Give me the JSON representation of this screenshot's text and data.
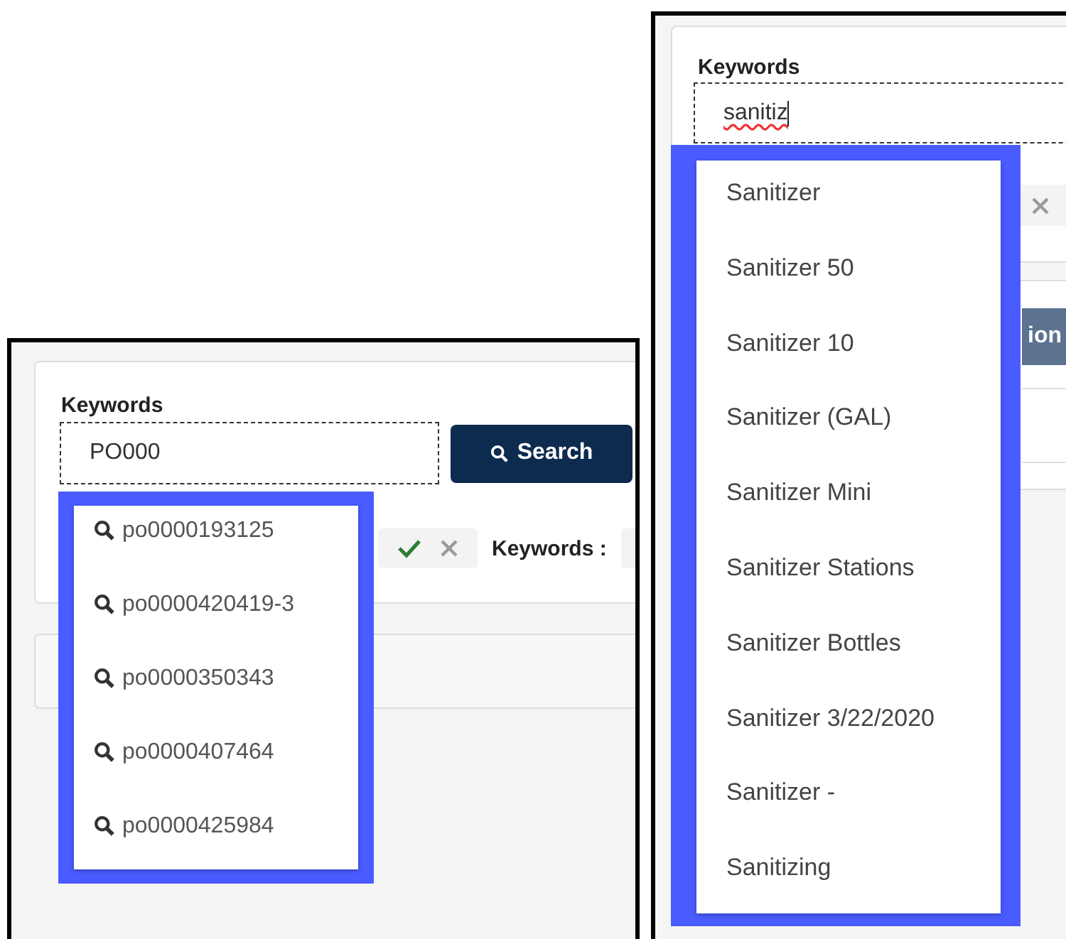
{
  "left_example": {
    "keywords_label": "Keywords",
    "query": "PO000",
    "query_misspelled": false,
    "search_button": "Search",
    "filter_label": "Keywords :",
    "suggestion_icon": true,
    "suggestions": [
      "po0000193125",
      "po0000420419-3",
      "po0000350343",
      "po0000407464",
      "po0000425984"
    ]
  },
  "right_example": {
    "keywords_label": "Keywords",
    "query": "sanitiz",
    "query_misspelled": true,
    "action_button": "ion",
    "suggestion_icon": false,
    "suggestions": [
      "Sanitizer",
      "Sanitizer 50",
      "Sanitizer 10",
      "Sanitizer (GAL)",
      "Sanitizer Mini",
      "Sanitizer Stations",
      "Sanitizer Bottles",
      "Sanitizer 3/22/2020",
      "Sanitizer -",
      "Sanitizing"
    ]
  }
}
